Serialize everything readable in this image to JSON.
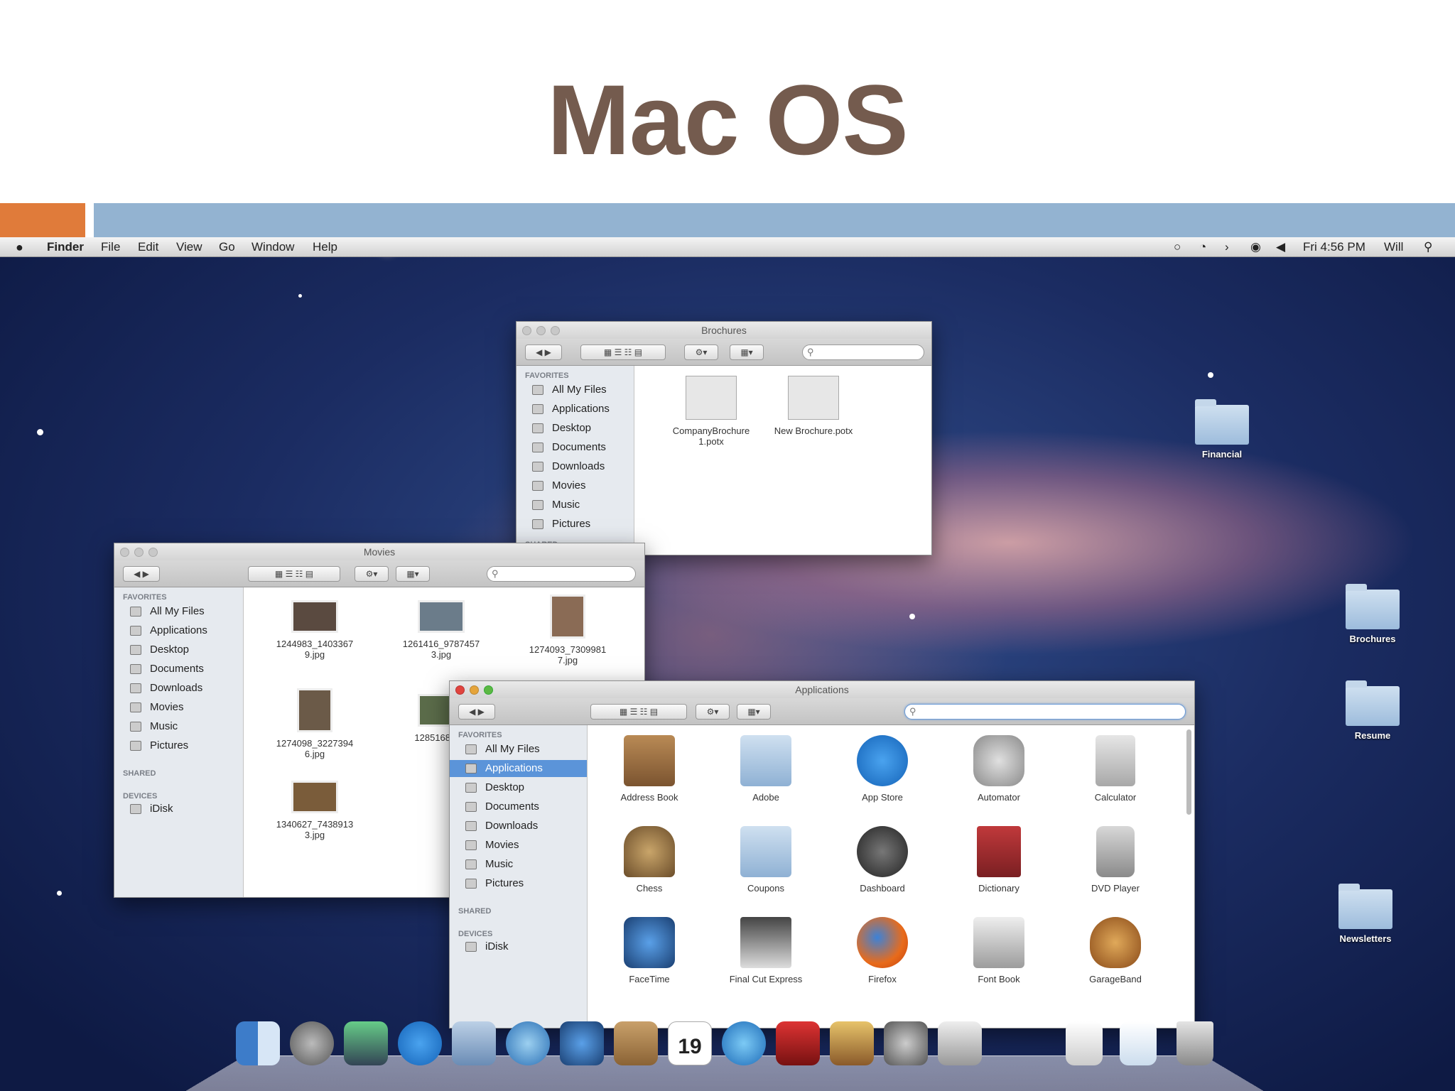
{
  "slide": {
    "title": "Mac OS"
  },
  "menubar": {
    "apple": "",
    "app": "Finder",
    "menus": [
      "File",
      "Edit",
      "View",
      "Go",
      "Window",
      "Help"
    ],
    "right": {
      "time": "Fri 4:56 PM",
      "user": "Will"
    }
  },
  "brochures": {
    "title": "Brochures",
    "favorites_heading": "FAVORITES",
    "sidebar": [
      "All My Files",
      "Applications",
      "Desktop",
      "Documents",
      "Downloads",
      "Movies",
      "Music",
      "Pictures"
    ],
    "shared_heading": "SHARED",
    "files": [
      "CompanyBrochure 1.potx",
      "New Brochure.potx"
    ]
  },
  "movies": {
    "title": "Movies",
    "favorites_heading": "FAVORITES",
    "sidebar": [
      "All My Files",
      "Applications",
      "Desktop",
      "Documents",
      "Downloads",
      "Movies",
      "Music",
      "Pictures"
    ],
    "shared_heading": "SHARED",
    "devices_heading": "DEVICES",
    "device": "iDisk",
    "files": [
      "1244983_1403367 9.jpg",
      "1261416_9787457 3.jpg",
      "1274093_7309981 7.jpg",
      "1274098_3227394 6.jpg",
      "1285168_ 0.j",
      "1340627_7438913 3.jpg"
    ]
  },
  "applications": {
    "title": "Applications",
    "favorites_heading": "FAVORITES",
    "sidebar": [
      "All My Files",
      "Applications",
      "Desktop",
      "Documents",
      "Downloads",
      "Movies",
      "Music",
      "Pictures"
    ],
    "selected": "Applications",
    "shared_heading": "SHARED",
    "devices_heading": "DEVICES",
    "device": "iDisk",
    "apps": [
      "Address Book",
      "Adobe",
      "App Store",
      "Automator",
      "Calculator",
      "Chess",
      "Coupons",
      "Dashboard",
      "Dictionary",
      "DVD Player",
      "FaceTime",
      "Final Cut Express",
      "Firefox",
      "Font Book",
      "GarageBand"
    ]
  },
  "desktop_folders": [
    "Financial",
    "Brochures",
    "Resume",
    "Newsletters"
  ],
  "dock": {
    "calendar_day": "19"
  },
  "colors": {
    "title": "#745b4e",
    "accent_orange": "#e07b3a",
    "accent_blue": "#93b3d1",
    "selection": "#5b94d9"
  }
}
